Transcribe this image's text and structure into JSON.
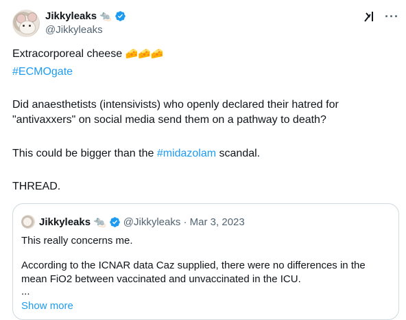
{
  "author": {
    "display_name": "Jikkyleaks",
    "emoji": "🐀",
    "handle": "@Jikkyleaks"
  },
  "icons": {
    "grok": "grok-icon",
    "more": "more-icon",
    "verified": "verified-badge-icon",
    "verified_color": "#1d9bf0"
  },
  "tweet": {
    "line1_text": "Extracorporeal cheese",
    "line1_emoji": "🧀🧀🧀",
    "hashtag1": "#ECMOgate",
    "para2": "Did anaesthetists (intensivists) who openly declared their hatred for \"antivaxxers\" on social media send them on a pathway to death?",
    "para3_before": "This could be bigger than the ",
    "para3_hashtag": "#midazolam",
    "para3_after": " scandal.",
    "para4": "THREAD."
  },
  "quoted": {
    "display_name": "Jikkyleaks",
    "emoji": "🐀",
    "handle_date": "@Jikkyleaks · Mar 3, 2023",
    "line1": "This really concerns me.",
    "para2": "According to the ICNAR data Caz supplied, there were no differences in the mean FiO2 between vaccinated and unvaccinated in the ICU.",
    "ellipsis": "...",
    "show_more": "Show more"
  },
  "colors": {
    "link": "#1d9bf0",
    "secondary_text": "#536471",
    "border": "#cfd9de"
  }
}
